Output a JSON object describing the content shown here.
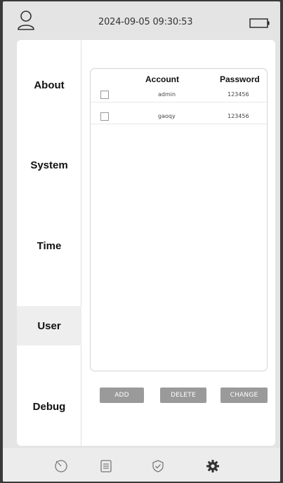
{
  "status_bar": {
    "datetime": "2024-09-05  09:30:53",
    "left_icon": "user-icon",
    "right_icon": "battery-icon"
  },
  "sidebar": {
    "items": [
      {
        "label": "About",
        "active": false
      },
      {
        "label": "System",
        "active": false
      },
      {
        "label": "Time",
        "active": false
      },
      {
        "label": "User",
        "active": true
      },
      {
        "label": "Debug",
        "active": false
      }
    ]
  },
  "user_table": {
    "columns": [
      "Account",
      "Password"
    ],
    "rows": [
      {
        "account": "admin",
        "password": "123456",
        "checked": false
      },
      {
        "account": "gaoqy",
        "password": "123456",
        "checked": false
      }
    ]
  },
  "actions": {
    "add_label": "ADD",
    "delete_label": "DELETE",
    "change_label": "CHANGE"
  },
  "bottom_nav": {
    "items": [
      {
        "icon": "timer-icon"
      },
      {
        "icon": "list-icon"
      },
      {
        "icon": "shield-check-icon"
      },
      {
        "icon": "gear-icon",
        "active": true
      }
    ]
  },
  "colors": {
    "background": "#e4e4e4",
    "panel": "#ffffff",
    "active_item": "#eeeeee",
    "button": "#9a9a9a"
  }
}
